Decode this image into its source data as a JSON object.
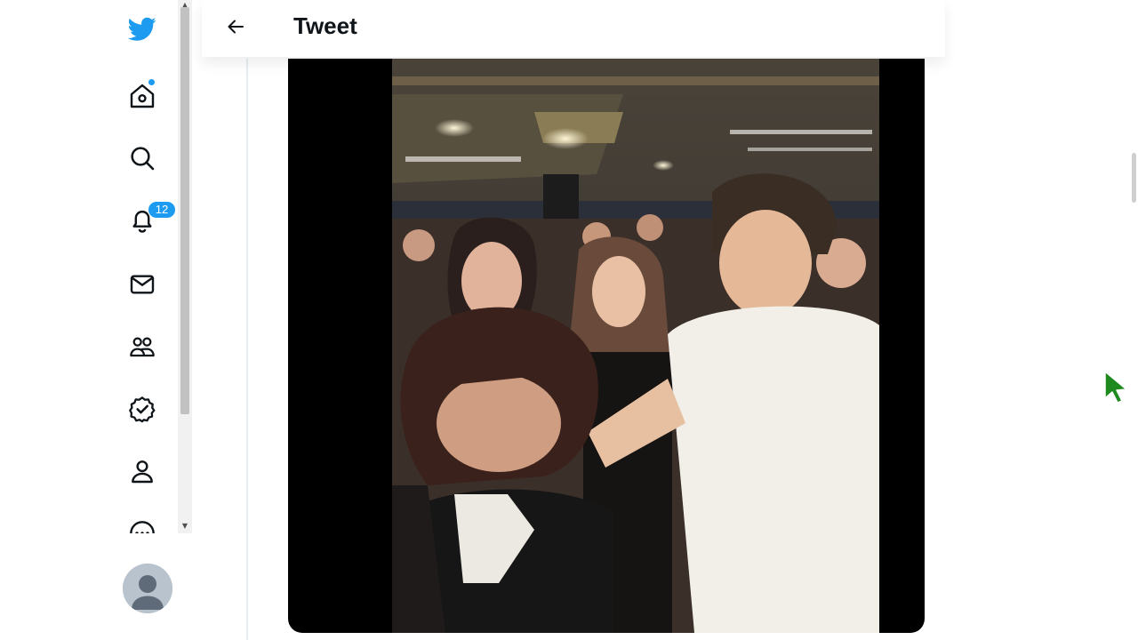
{
  "nav": {
    "items": [
      {
        "name": "logo",
        "icon": "twitter-bird-icon"
      },
      {
        "name": "home",
        "icon": "home-icon",
        "has_new": true
      },
      {
        "name": "explore",
        "icon": "search-icon"
      },
      {
        "name": "notifications",
        "icon": "bell-icon",
        "badge": "12"
      },
      {
        "name": "messages",
        "icon": "mail-icon"
      },
      {
        "name": "communities",
        "icon": "people-icon"
      },
      {
        "name": "verified",
        "icon": "verified-badge-icon"
      },
      {
        "name": "profile",
        "icon": "person-icon"
      },
      {
        "name": "more",
        "icon": "more-circle-icon"
      }
    ],
    "accent": "#1d9bf0"
  },
  "header": {
    "title": "Tweet",
    "back_icon": "arrow-left-icon"
  },
  "media": {
    "type": "video"
  }
}
